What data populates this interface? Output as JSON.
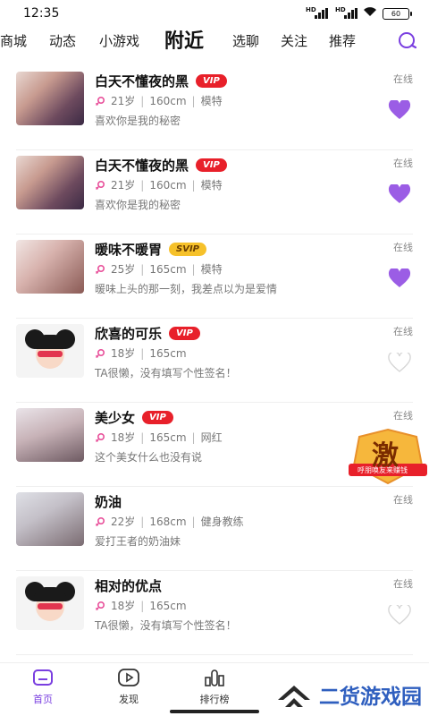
{
  "status_bar": {
    "time": "12:35",
    "signal_label": "HD",
    "battery": "60"
  },
  "tabs": [
    {
      "label": "商城"
    },
    {
      "label": "动态"
    },
    {
      "label": "小游戏"
    },
    {
      "label": "附近"
    },
    {
      "label": "选聊"
    },
    {
      "label": "关注"
    },
    {
      "label": "推荐"
    }
  ],
  "active_tab": "附近",
  "users": [
    {
      "name": "白天不懂夜的黑",
      "badge": "VIP",
      "age": "21岁",
      "height": "160cm",
      "job": "模特",
      "bio": "喜欢你是我的秘密",
      "status": "在线",
      "liked": true
    },
    {
      "name": "白天不懂夜的黑",
      "badge": "VIP",
      "age": "21岁",
      "height": "160cm",
      "job": "模特",
      "bio": "喜欢你是我的秘密",
      "status": "在线",
      "liked": true
    },
    {
      "name": "暖味不暖胃",
      "badge": "SVIP",
      "age": "25岁",
      "height": "165cm",
      "job": "模特",
      "bio": "暖味上头的那一刻，我差点以为是爱情",
      "status": "在线",
      "liked": true
    },
    {
      "name": "欣喜的可乐",
      "badge": "VIP",
      "age": "18岁",
      "height": "165cm",
      "job": "",
      "bio": "TA很懒，没有填写个性签名！",
      "status": "在线",
      "liked": false
    },
    {
      "name": "美少女",
      "badge": "VIP",
      "age": "18岁",
      "height": "165cm",
      "job": "网红",
      "bio": "这个美女什么也没有说",
      "status": "在线",
      "liked": false
    },
    {
      "name": "奶油",
      "badge": "",
      "age": "22岁",
      "height": "168cm",
      "job": "健身教练",
      "bio": "爱打王者的奶油妹",
      "status": "在线",
      "liked": false
    },
    {
      "name": "相对的优点",
      "badge": "",
      "age": "18岁",
      "height": "165cm",
      "job": "",
      "bio": "TA很懒，没有填写个性签名！",
      "status": "在线",
      "liked": false
    }
  ],
  "promo": {
    "char": "激",
    "caption": "呼朋唤友来赚钱"
  },
  "bottom_nav": [
    {
      "label": "首页"
    },
    {
      "label": "发现"
    },
    {
      "label": "排行榜"
    }
  ],
  "watermark": {
    "text": "二货游戏园"
  },
  "colors": {
    "accent": "#7a3fe0",
    "heart_on": "#9b5de5",
    "vip": "#e8202a",
    "svip": "#f6c12a"
  },
  "icons": {
    "search": "search-icon",
    "heart": "heart-icon",
    "gender": "female-icon"
  }
}
